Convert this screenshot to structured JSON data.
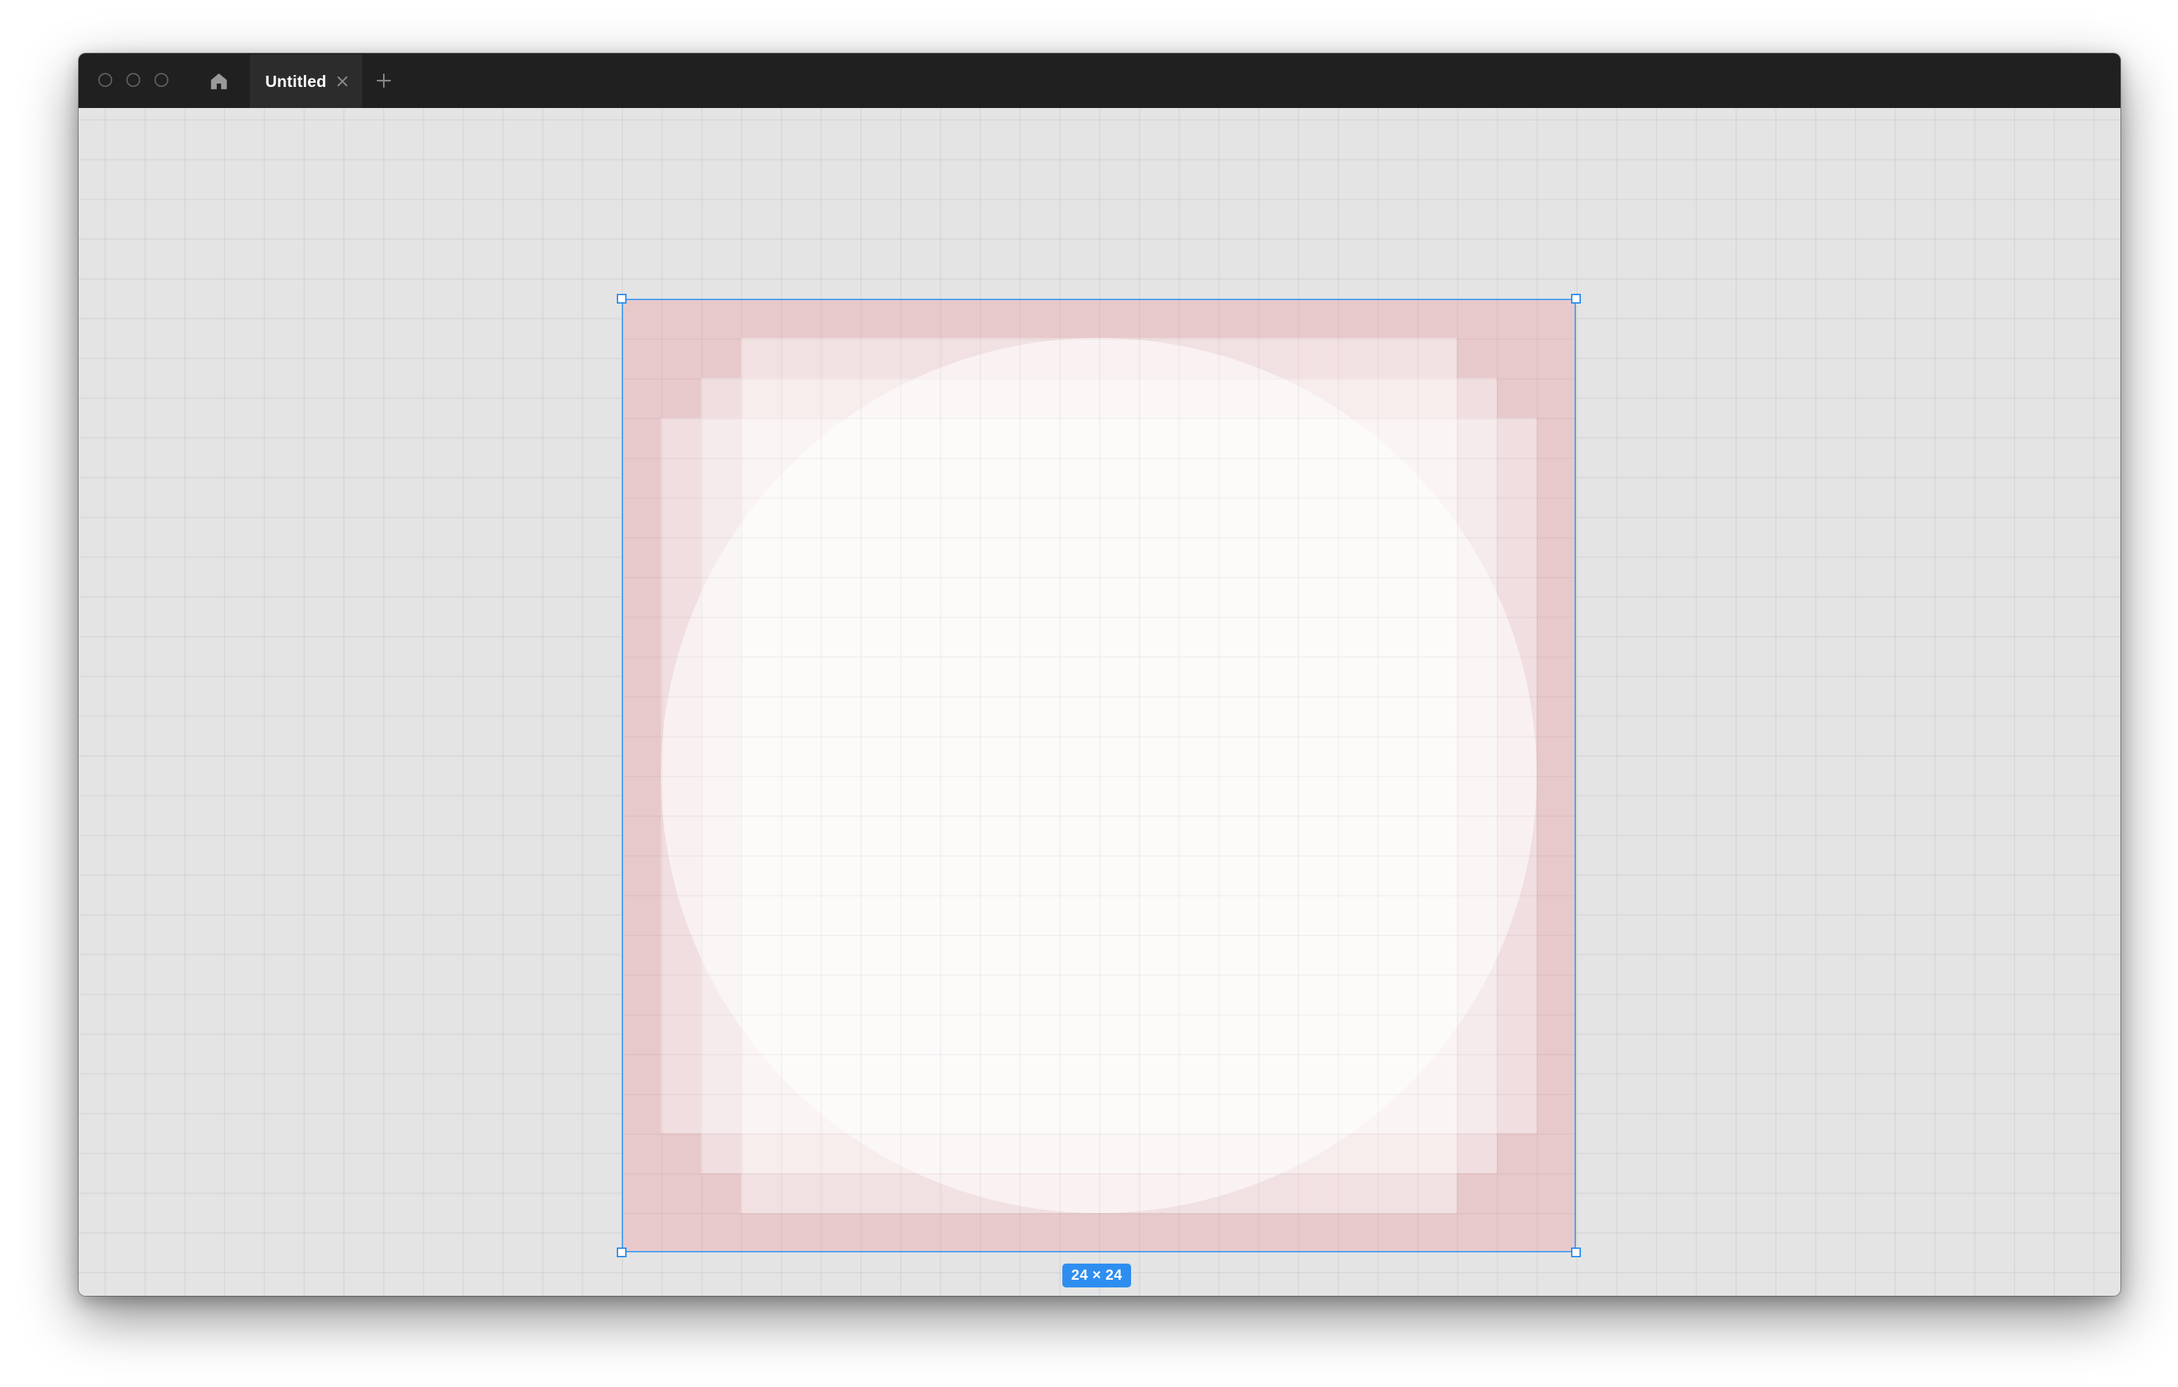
{
  "window": {
    "tabs": [
      {
        "label": "Untitled",
        "active": true
      }
    ]
  },
  "selection": {
    "size_label": "24 × 24"
  },
  "icons": {
    "home": "home-icon",
    "close": "close-icon",
    "new_tab": "plus-icon"
  },
  "colors": {
    "accent": "#2e8ef0",
    "frame_fill": "#e8c9cb",
    "titlebar": "#202020",
    "canvas": "#e4e4e4"
  }
}
